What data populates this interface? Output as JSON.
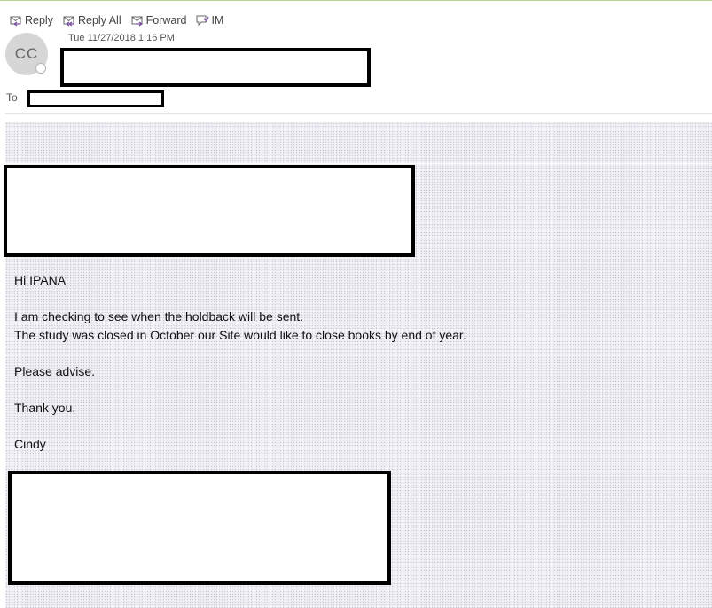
{
  "toolbar": {
    "reply_label": "Reply",
    "reply_all_label": "Reply All",
    "forward_label": "Forward",
    "im_label": "IM"
  },
  "header": {
    "avatar_initials": "CC",
    "date": "Tue 11/27/2018 1:16 PM",
    "to_label": "To"
  },
  "message": {
    "greeting": "Hi IPANA",
    "line1": "I am checking to see when the holdback will be sent.",
    "line2": "The study was closed in October our Site would like to close books by end of year.",
    "line3": "Please advise.",
    "line4": "Thank you.",
    "signoff": "Cindy"
  },
  "colors": {
    "accent_icon": "#7b4fa3",
    "top_border": "#b7d58f"
  }
}
